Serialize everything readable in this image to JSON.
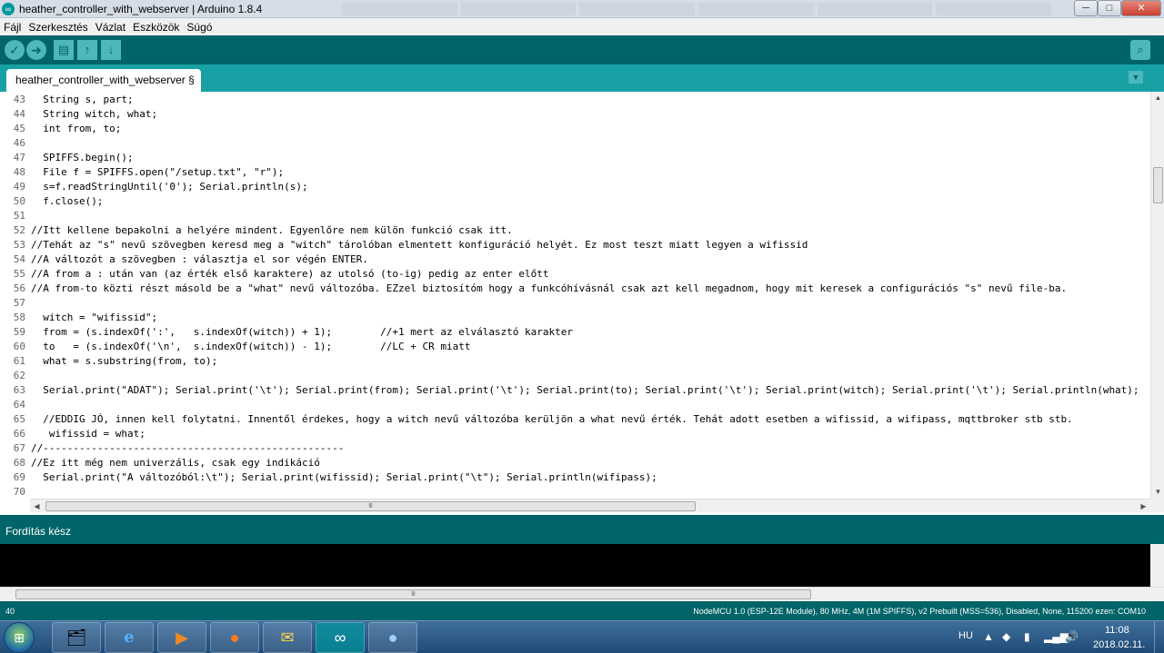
{
  "window": {
    "title": "heather_controller_with_webserver | Arduino 1.8.4",
    "app_icon": "arduino-icon",
    "controls": {
      "minimize": "─",
      "maximize": "□",
      "close": "✕"
    }
  },
  "menubar": {
    "items": [
      "Fájl",
      "Szerkesztés",
      "Vázlat",
      "Eszközök",
      "Súgó"
    ]
  },
  "toolbar": {
    "verify": "✓",
    "upload": "➜",
    "new": "▤",
    "open": "↑",
    "save": "↓",
    "serial_monitor": "⌕"
  },
  "tabs": {
    "active_label": "heather_controller_with_webserver §",
    "menu_glyph": "▼"
  },
  "editor": {
    "lines": [
      {
        "n": "43",
        "text": "  String s, part;"
      },
      {
        "n": "44",
        "text": "  String witch, what;"
      },
      {
        "n": "45",
        "text": "  int from, to;"
      },
      {
        "n": "46",
        "text": ""
      },
      {
        "n": "47",
        "text": "  SPIFFS.begin();"
      },
      {
        "n": "48",
        "text": "  File f = SPIFFS.open(\"/setup.txt\", \"r\");"
      },
      {
        "n": "49",
        "text": "  s=f.readStringUntil('0'); Serial.println(s);"
      },
      {
        "n": "50",
        "text": "  f.close();"
      },
      {
        "n": "51",
        "text": ""
      },
      {
        "n": "52",
        "text": "//Itt kellene bepakolni a helyére mindent. Egyenlőre nem külön funkció csak itt."
      },
      {
        "n": "53",
        "text": "//Tehát az \"s\" nevű szövegben keresd meg a \"witch\" tárolóban elmentett konfiguráció helyét. Ez most teszt miatt legyen a wifissid"
      },
      {
        "n": "54",
        "text": "//A változót a szövegben : választja el sor végén ENTER."
      },
      {
        "n": "55",
        "text": "//A from a : után van (az érték első karaktere) az utolsó (to-ig) pedig az enter előtt"
      },
      {
        "n": "56",
        "text": "//A from-to közti részt másold be a \"what\" nevű változóba. EZzel biztosítóm hogy a funkcóhívásnál csak azt kell megadnom, hogy mit keresek a configurációs \"s\" nevű file-ba."
      },
      {
        "n": "57",
        "text": ""
      },
      {
        "n": "58",
        "text": "  witch = \"wifissid\";"
      },
      {
        "n": "59",
        "text": "  from = (s.indexOf(':',   s.indexOf(witch)) + 1);        //+1 mert az elválasztó karakter"
      },
      {
        "n": "60",
        "text": "  to   = (s.indexOf('\\n',  s.indexOf(witch)) - 1);        //LC + CR miatt"
      },
      {
        "n": "61",
        "text": "  what = s.substring(from, to);"
      },
      {
        "n": "62",
        "text": ""
      },
      {
        "n": "63",
        "text": "  Serial.print(\"ADAT\"); Serial.print('\\t'); Serial.print(from); Serial.print('\\t'); Serial.print(to); Serial.print('\\t'); Serial.print(witch); Serial.print('\\t'); Serial.println(what);"
      },
      {
        "n": "64",
        "text": ""
      },
      {
        "n": "65",
        "text": "  //EDDIG JÓ, innen kell folytatni. Innentől érdekes, hogy a witch nevű változóba kerüljön a what nevű érték. Tehát adott esetben a wifissid, a wifipass, mqttbroker stb stb."
      },
      {
        "n": "66",
        "text": "   wifissid = what;"
      },
      {
        "n": "67",
        "text": "//--------------------------------------------------"
      },
      {
        "n": "68",
        "text": "//Ez itt még nem univerzális, csak egy indikáció"
      },
      {
        "n": "69",
        "text": "  Serial.print(\"A változóból:\\t\"); Serial.print(wifissid); Serial.print(\"\\t\"); Serial.println(wifipass);"
      },
      {
        "n": "70",
        "text": ""
      }
    ]
  },
  "status": {
    "message": "Fordítás kész"
  },
  "boardbar": {
    "line_number": "40",
    "board_info": "NodeMCU 1.0 (ESP-12E Module), 80 MHz, 4M (1M SPIFFS), v2 Prebuilt (MSS=536), Disabled, None, 115200 ezen: COM10"
  },
  "taskbar": {
    "start_icon": "windows-start-icon",
    "apps": [
      {
        "name": "file-explorer-icon",
        "glyph": "📁"
      },
      {
        "name": "internet-explorer-icon",
        "glyph": "e"
      },
      {
        "name": "media-player-icon",
        "glyph": "▶"
      },
      {
        "name": "firefox-icon",
        "glyph": "●"
      },
      {
        "name": "mail-icon",
        "glyph": "✉"
      },
      {
        "name": "arduino-icon",
        "glyph": "∞"
      },
      {
        "name": "droplet-app-icon",
        "glyph": "💧"
      }
    ],
    "language": "HU",
    "clock_time": "11:08",
    "clock_date": "2018.02.11."
  }
}
